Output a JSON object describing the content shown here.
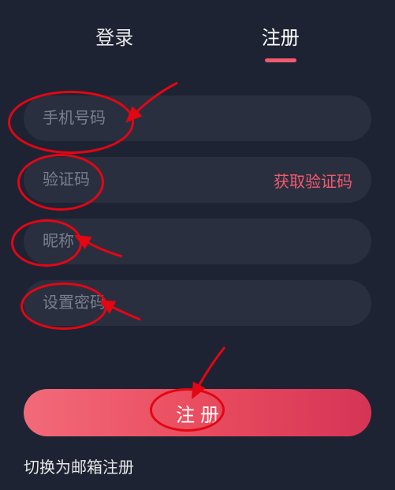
{
  "tabs": {
    "login": "登录",
    "register": "注册"
  },
  "form": {
    "phone_placeholder": "手机号码",
    "code_placeholder": "验证码",
    "get_code_label": "获取验证码",
    "nickname_placeholder": "昵称",
    "password_placeholder": "设置密码"
  },
  "submit_label": "注 册",
  "switch_link_label": "切换为邮箱注册"
}
